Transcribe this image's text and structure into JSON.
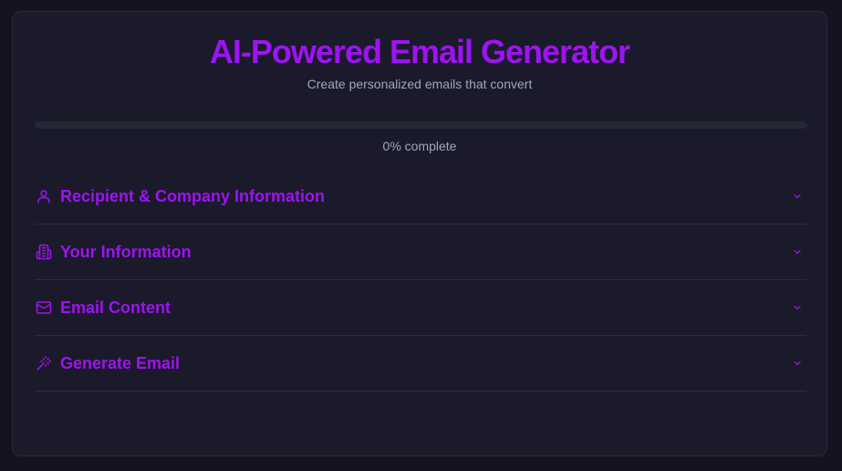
{
  "header": {
    "title": "AI-Powered Email Generator",
    "subtitle": "Create personalized emails that convert"
  },
  "progress": {
    "percent": 0,
    "label": "0% complete"
  },
  "sections": [
    {
      "label": "Recipient & Company Information",
      "icon": "user-icon"
    },
    {
      "label": "Your Information",
      "icon": "building-icon"
    },
    {
      "label": "Email Content",
      "icon": "mail-icon"
    },
    {
      "label": "Generate Email",
      "icon": "magic-wand-icon"
    }
  ],
  "colors": {
    "accent": "#9d13f2",
    "background": "#14131f",
    "card": "#1b1a2b",
    "muted_text": "#a3a5bd"
  }
}
